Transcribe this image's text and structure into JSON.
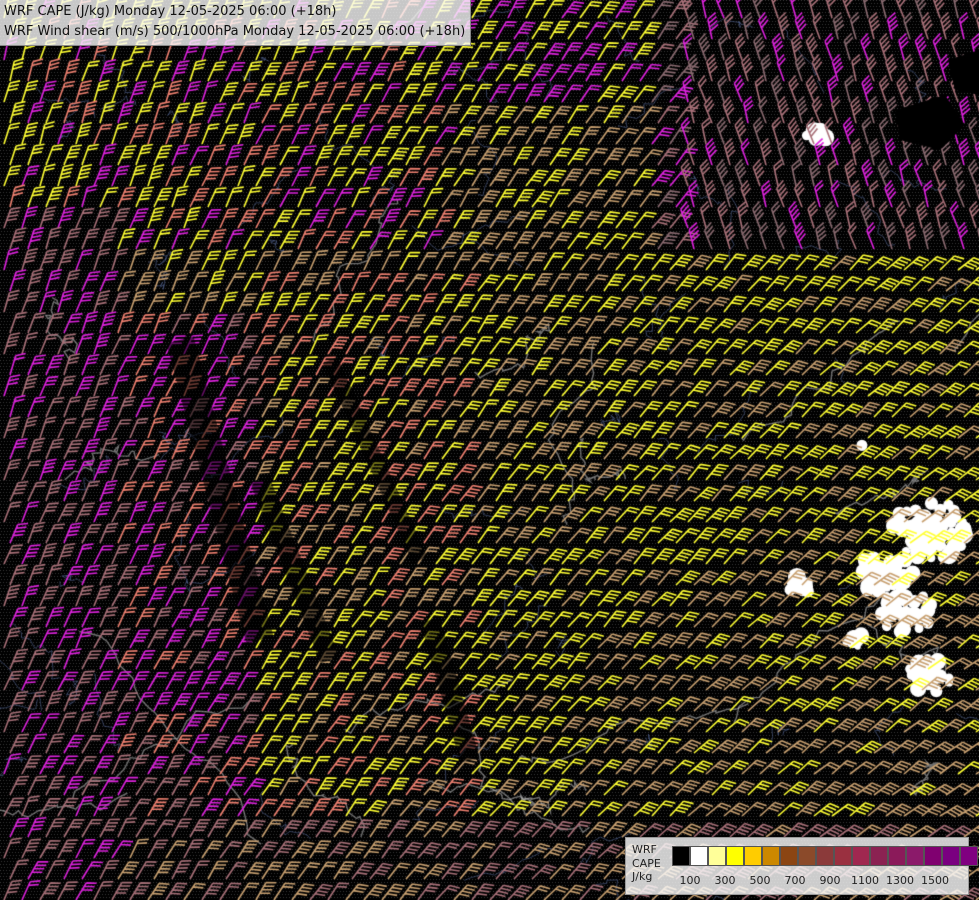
{
  "header": {
    "title_line_1": "WRF CAPE (J/kg) Monday 12-05-2025 06:00 (+18h)",
    "title_line_2": "WRF Wind shear (m/s) 500/1000hPa Monday 12-05-2025 06:00 (+18h)"
  },
  "legend": {
    "label_model": "WRF",
    "label_field": "CAPE",
    "label_units": "J/kg",
    "colors": [
      "#000000",
      "#ffffff",
      "#ffff99",
      "#ffff00",
      "#ffcc00",
      "#cc8800",
      "#8b4513",
      "#8b4a2a",
      "#8b3a3a",
      "#9a3040",
      "#a02850",
      "#8b2252",
      "#8b1a5a",
      "#8b1a6a",
      "#800070",
      "#7a0080",
      "#800080"
    ],
    "ticks": [
      "100",
      "300",
      "500",
      "700",
      "900",
      "1100",
      "1300",
      "1500"
    ]
  },
  "wind_palette": {
    "yellow": "#ffff33",
    "tan": "#c8a070",
    "salmon": "#ef8070",
    "magenta": "#dd22dd",
    "mauve": "#a87078"
  },
  "cape_patch_color": "#ffffff"
}
